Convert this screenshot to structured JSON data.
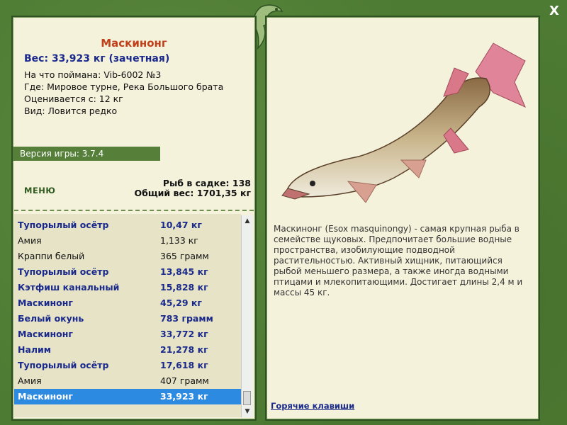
{
  "fish": {
    "name": "Маскинонг",
    "weight_line": "Вес: 33,923 кг (зачетная)",
    "caught_on": "На что поймана: Vib-6002 №3",
    "where": "Где: Мировое турне, Река Большого брата",
    "rated_from": "Оценивается с: 12 кг",
    "kind": "Вид: Ловится редко"
  },
  "version": "Версия игры: 3.7.4",
  "menu_label": "МЕНЮ",
  "stats": {
    "fish_count": "Рыб в садке: 138",
    "total_weight": "Общий вес: 1701,35 кг"
  },
  "catches": [
    {
      "name": "Тупорылый осётр",
      "weight": "10,47 кг",
      "trophy": true
    },
    {
      "name": "Амия",
      "weight": "1,133 кг",
      "trophy": false
    },
    {
      "name": "Краппи белый",
      "weight": "365 грамм",
      "trophy": false
    },
    {
      "name": "Тупорылый осётр",
      "weight": "13,845 кг",
      "trophy": true
    },
    {
      "name": "Кэтфиш канальный",
      "weight": "15,828 кг",
      "trophy": true
    },
    {
      "name": "Маскинонг",
      "weight": "45,29 кг",
      "trophy": true
    },
    {
      "name": "Белый окунь",
      "weight": "783 грамм",
      "trophy": true
    },
    {
      "name": "Маскинонг",
      "weight": "33,772 кг",
      "trophy": true
    },
    {
      "name": "Налим",
      "weight": "21,278 кг",
      "trophy": true
    },
    {
      "name": "Тупорылый осётр",
      "weight": "17,618 кг",
      "trophy": true
    },
    {
      "name": "Амия",
      "weight": "407 грамм",
      "trophy": false
    },
    {
      "name": "Маскинонг",
      "weight": "33,923 кг",
      "trophy": true,
      "selected": true
    }
  ],
  "description": "Маскинонг (Esox masquinongy) - самая крупная рыба в семействе щуковых. Предпочитает большие водные пространства, изобилующие подводной растительностью. Активный хищник, питающийся рыбой меньшего размера, а также иногда водными птицами и млекопитающими. Достигает длины 2,4 м и массы 45 кг.",
  "hotkeys_label": "Горячие клавиши",
  "close_label": "X",
  "icons": {
    "close": "close-icon",
    "ornament": "fish-ornament-icon",
    "scroll_up": "scroll-up-arrow-icon",
    "scroll_down": "scroll-down-arrow-icon"
  },
  "colors": {
    "frame": "#4e7b33",
    "panel": "#f5f2dc",
    "title": "#c0401a",
    "trophy_text": "#1a2a8c",
    "selected_row": "#2c8ae0",
    "version_bar": "#56803a"
  }
}
